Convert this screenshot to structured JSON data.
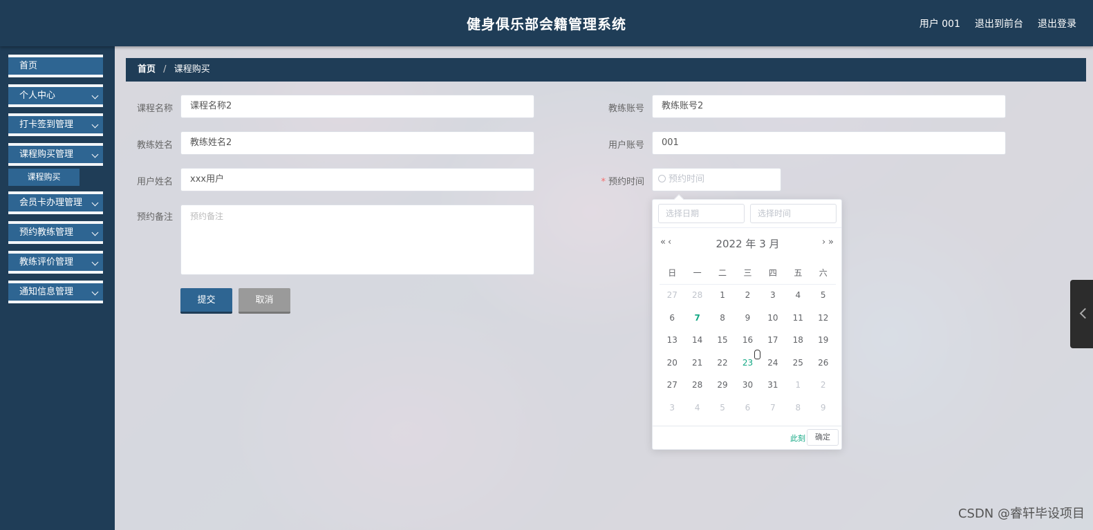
{
  "header": {
    "title": "健身俱乐部会籍管理系统",
    "user": "用户 001",
    "front": "退出到前台",
    "logout": "退出登录"
  },
  "sidebar": {
    "items": [
      {
        "label": "首页"
      },
      {
        "label": "个人中心"
      },
      {
        "label": "打卡签到管理"
      },
      {
        "label": "课程购买管理"
      },
      {
        "label": "会员卡办理管理"
      },
      {
        "label": "预约教练管理"
      },
      {
        "label": "教练评价管理"
      },
      {
        "label": "通知信息管理"
      }
    ],
    "submenu": "课程购买"
  },
  "breadcrumb": {
    "home": "首页",
    "separator": "/",
    "current": "课程购买"
  },
  "form": {
    "course_name": {
      "label": "课程名称",
      "value": "课程名称2"
    },
    "coach_account": {
      "label": "教练账号",
      "value": "教练账号2"
    },
    "coach_name": {
      "label": "教练姓名",
      "value": "教练姓名2"
    },
    "user_account": {
      "label": "用户账号",
      "value": "001"
    },
    "user_name": {
      "label": "用户姓名",
      "value": "xxx用户"
    },
    "appointment_time": {
      "label": "预约时间",
      "required_mark": "*",
      "placeholder": "预约时间"
    },
    "remark": {
      "label": "预约备注",
      "placeholder": "预约备注"
    },
    "submit": "提交",
    "cancel": "取消"
  },
  "datepicker": {
    "date_placeholder": "选择日期",
    "time_placeholder": "选择时间",
    "prev_year": "«",
    "prev_month": "‹",
    "next_month": "›",
    "next_year": "»",
    "year_label": "2022 年",
    "month_label": "3 月",
    "weekdays": [
      "日",
      "一",
      "二",
      "三",
      "四",
      "五",
      "六"
    ],
    "weeks": [
      [
        {
          "d": "27",
          "t": "other"
        },
        {
          "d": "28",
          "t": "other"
        },
        {
          "d": "1",
          "t": ""
        },
        {
          "d": "2",
          "t": ""
        },
        {
          "d": "3",
          "t": ""
        },
        {
          "d": "4",
          "t": ""
        },
        {
          "d": "5",
          "t": ""
        }
      ],
      [
        {
          "d": "6",
          "t": ""
        },
        {
          "d": "7",
          "t": "today"
        },
        {
          "d": "8",
          "t": ""
        },
        {
          "d": "9",
          "t": ""
        },
        {
          "d": "10",
          "t": ""
        },
        {
          "d": "11",
          "t": ""
        },
        {
          "d": "12",
          "t": ""
        }
      ],
      [
        {
          "d": "13",
          "t": ""
        },
        {
          "d": "14",
          "t": ""
        },
        {
          "d": "15",
          "t": ""
        },
        {
          "d": "16",
          "t": ""
        },
        {
          "d": "17",
          "t": ""
        },
        {
          "d": "18",
          "t": ""
        },
        {
          "d": "19",
          "t": ""
        }
      ],
      [
        {
          "d": "20",
          "t": ""
        },
        {
          "d": "21",
          "t": ""
        },
        {
          "d": "22",
          "t": ""
        },
        {
          "d": "23",
          "t": "sel"
        },
        {
          "d": "24",
          "t": ""
        },
        {
          "d": "25",
          "t": ""
        },
        {
          "d": "26",
          "t": ""
        }
      ],
      [
        {
          "d": "27",
          "t": ""
        },
        {
          "d": "28",
          "t": ""
        },
        {
          "d": "29",
          "t": ""
        },
        {
          "d": "30",
          "t": ""
        },
        {
          "d": "31",
          "t": ""
        },
        {
          "d": "1",
          "t": "other"
        },
        {
          "d": "2",
          "t": "other"
        }
      ],
      [
        {
          "d": "3",
          "t": "other"
        },
        {
          "d": "4",
          "t": "other"
        },
        {
          "d": "5",
          "t": "other"
        },
        {
          "d": "6",
          "t": "other"
        },
        {
          "d": "7",
          "t": "other"
        },
        {
          "d": "8",
          "t": "other"
        },
        {
          "d": "9",
          "t": "other"
        }
      ]
    ],
    "now": "此刻",
    "confirm": "确定"
  },
  "watermark": "CSDN @睿轩毕设项目",
  "colors": {
    "header_bg": "#1f3d57",
    "menu_bg": "#2e6592",
    "accent": "#13a884",
    "required": "#f56c6c"
  }
}
